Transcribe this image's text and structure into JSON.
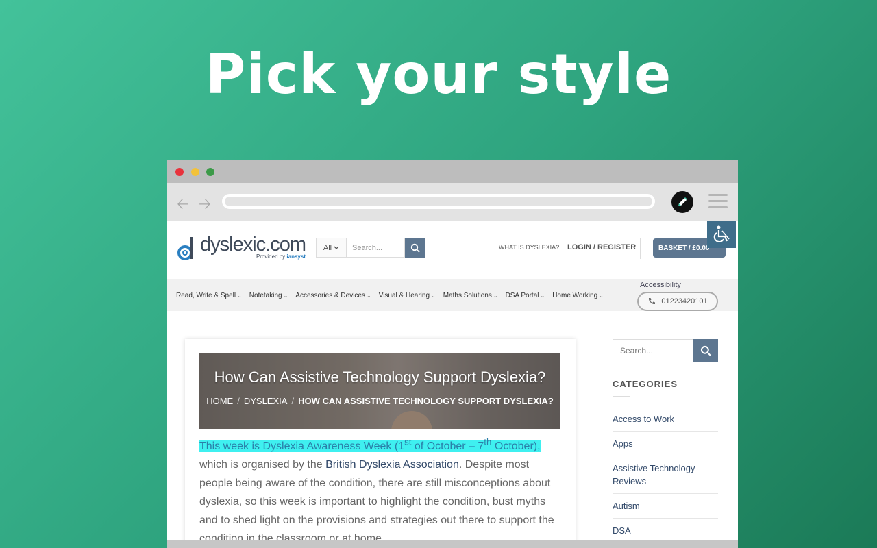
{
  "hero": {
    "title": "Pick your style"
  },
  "browser": {
    "site": {
      "logo": {
        "word": "dyslexic.com",
        "provided_by": "Provided by",
        "brand": "iansyst"
      },
      "search": {
        "category": "All",
        "placeholder": "Search..."
      },
      "header_links": {
        "what_is": "WHAT IS DYSLEXIA?",
        "login": "LOGIN / REGISTER"
      },
      "basket": "BASKET / £0.00",
      "accessibility_label": "Accessibility",
      "phone": "01223420101",
      "nav": [
        "Read, Write & Spell",
        "Notetaking",
        "Accessories & Devices",
        "Visual & Hearing",
        "Maths Solutions",
        "DSA Portal",
        "Home Working"
      ],
      "article": {
        "heading": "How Can Assistive Technology Support Dyslexia?",
        "breadcrumb": [
          "HOME",
          "DYSLEXIA",
          "HOW CAN ASSISTIVE TECHNOLOGY SUPPORT DYSLEXIA?"
        ],
        "highlight_a": "This week is Dyslexia Awareness Week (1",
        "sup1": "st",
        "highlight_b": " of October – 7",
        "sup2": "th",
        "highlight_c": " October),",
        "text1": " which is organised by the ",
        "link": "British Dyslexia Association",
        "text2": ". Despite most people being aware of the condition, there are still misconceptions about dyslexia, so this week is important to highlight the condition, bust myths and to shed light on the provisions and strategies out there to support the condition in the classroom or at home."
      },
      "sidebar": {
        "search_placeholder": "Search...",
        "categories_heading": "CATEGORIES",
        "categories": [
          "Access to Work",
          "Apps",
          "Assistive Technology Reviews",
          "Autism",
          "DSA"
        ]
      }
    }
  },
  "colors": {
    "accent": "#5d7690",
    "highlight": "#3ff0f0",
    "bg_start": "#43c29a",
    "bg_end": "#1b7a57"
  },
  "icons": [
    "back-arrow-icon",
    "forward-arrow-icon",
    "pen-extension-icon",
    "hamburger-menu-icon",
    "search-icon",
    "chevron-down-icon",
    "cart-icon",
    "wheelchair-icon",
    "phone-icon"
  ]
}
